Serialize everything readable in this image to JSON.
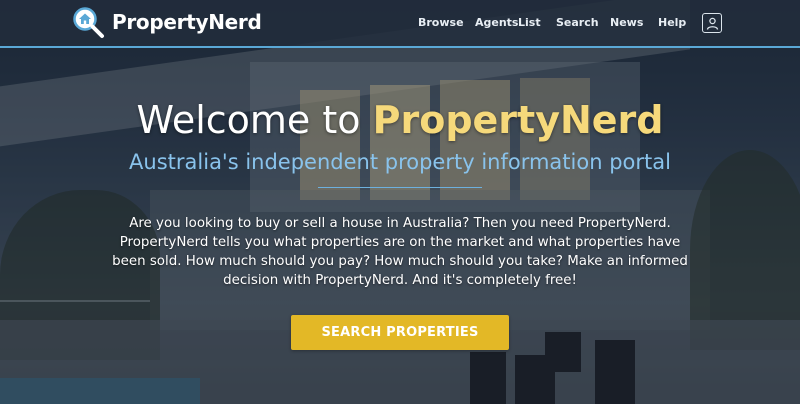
{
  "brand": {
    "name": "PropertyNerd"
  },
  "nav": {
    "browse": "Browse",
    "agents": "Agents",
    "list": "List",
    "search": "Search",
    "news": "News",
    "help": "Help",
    "user_icon": "user-account-icon"
  },
  "hero": {
    "title_prefix": "Welcome to ",
    "title_brand": "PropertyNerd",
    "subtitle": "Australia's independent property information portal",
    "description": "Are you looking to buy or sell a house in Australia? Then you need PropertyNerd. PropertyNerd tells you what properties are on the market and what properties have been sold. How much should you pay? How much should you take? Make an informed decision with PropertyNerd. And it's completely free!",
    "cta_label": "SEARCH PROPERTIES"
  },
  "colors": {
    "accent_blue": "#5aa8d6",
    "brand_yellow": "#f6d97b",
    "button_yellow": "#e3b826"
  }
}
